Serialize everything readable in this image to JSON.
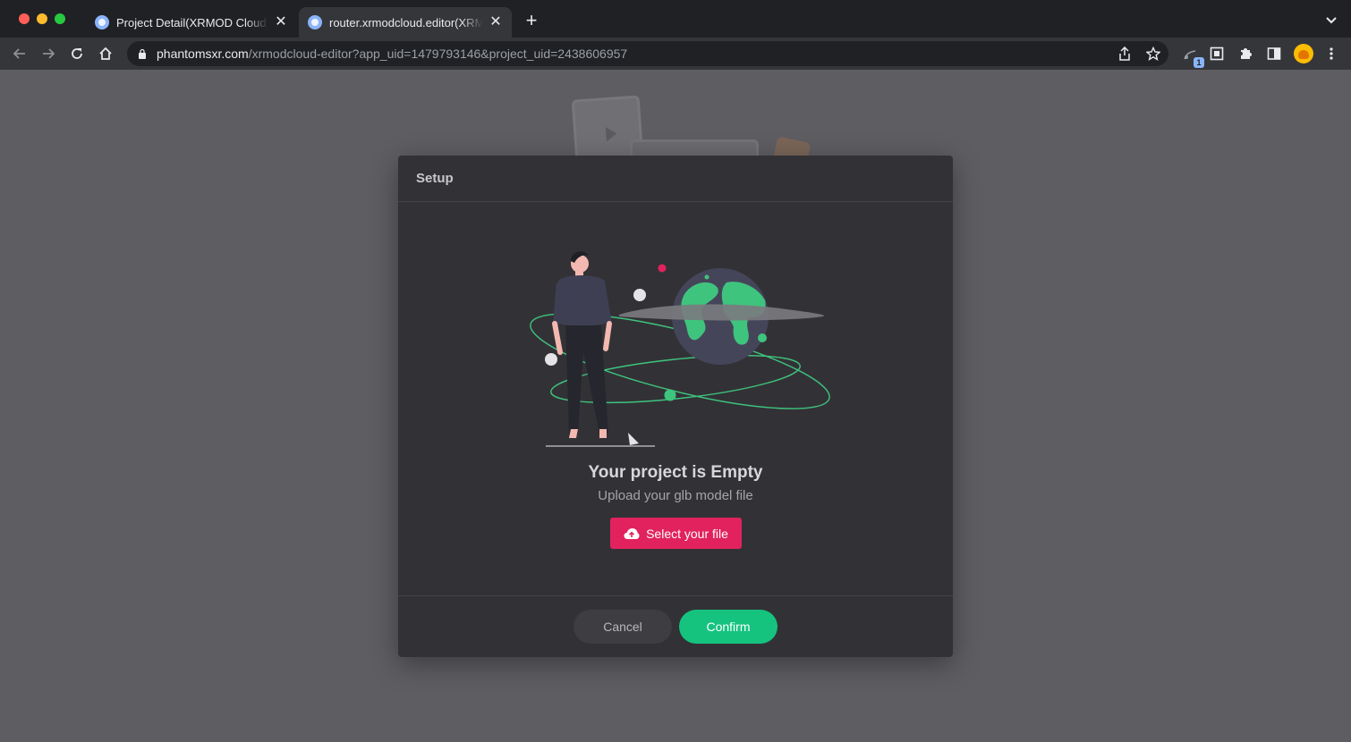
{
  "browser": {
    "tabs": [
      {
        "title": "Project Detail(XRMOD Cloud) - ",
        "close": "✕"
      },
      {
        "title": "router.xrmodcloud.editor(XRMOD",
        "close": "✕"
      }
    ],
    "new_tab": "+",
    "url_host": "phantomsxr.com",
    "url_path": "/xrmodcloud-editor?app_uid=1479793146&project_uid=2438606957",
    "extension_badge": "1",
    "icons": [
      "back-icon",
      "forward-icon",
      "reload-icon",
      "home-icon",
      "lock-icon",
      "share-icon",
      "star-icon",
      "extension-icon",
      "screenshot-icon",
      "puzzle-icon",
      "sidepanel-icon",
      "profile-avatar",
      "menu-icon"
    ]
  },
  "modal": {
    "title": "Setup",
    "empty_title": "Your project is Empty",
    "empty_subtitle": "Upload your glb model file",
    "select_label": "Select your file",
    "cancel_label": "Cancel",
    "confirm_label": "Confirm"
  },
  "colors": {
    "accent_pink": "#e2225e",
    "accent_green": "#15c37f",
    "modal_bg": "#323236",
    "overlay_bg": "#5d5d62"
  }
}
